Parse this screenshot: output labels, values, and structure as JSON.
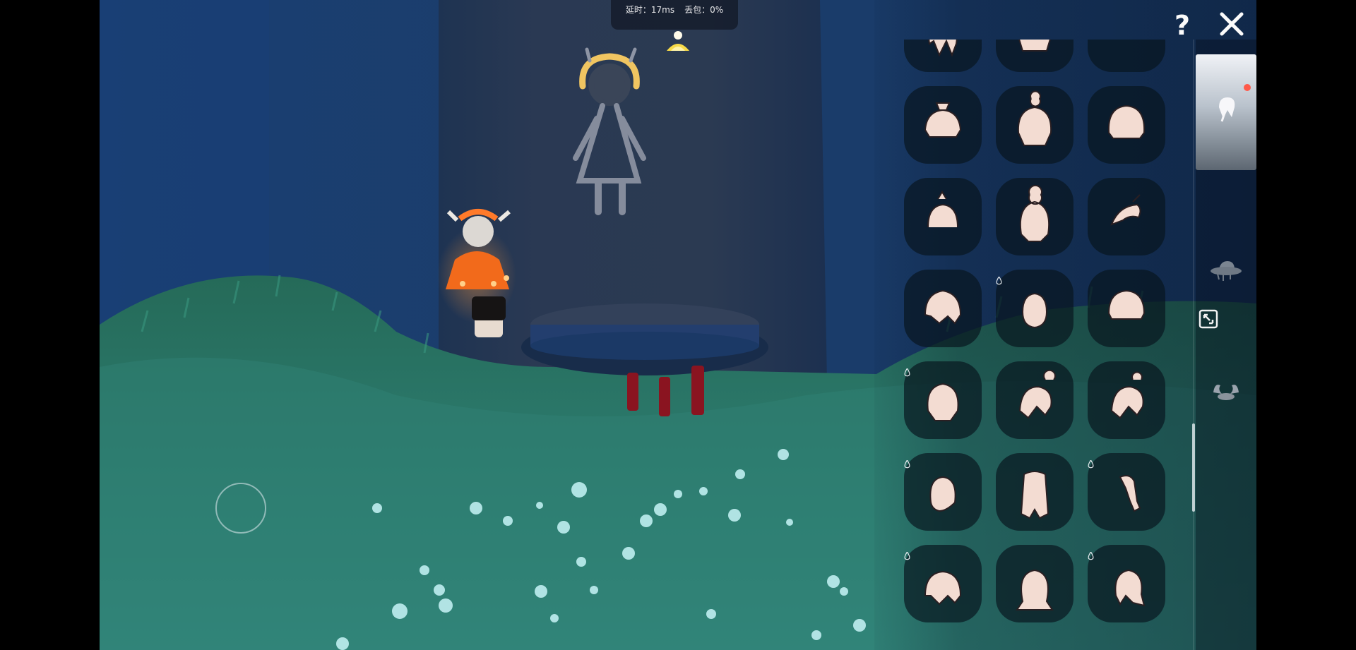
{
  "net_stats": {
    "latency": "延时：17ms",
    "packet_loss": "丢包：0%"
  },
  "help_label": "?",
  "icons": {
    "help": "question-mark-icon",
    "close": "close-x-icon",
    "expand": "expand-view-icon",
    "beacon": "candle-light-icon",
    "new_indicator": "red-dot-badge"
  },
  "colors": {
    "new_dot": "#ff5a4a",
    "slot_background": "#08141e",
    "hair_icon": "#f3dcd2",
    "accent_gold": "#f2c94c",
    "grass": "#2e7c72",
    "wall": "#173a6a"
  },
  "categories": [
    {
      "id": "hair",
      "icon": "hair-icon",
      "selected": true,
      "has_new": true
    },
    {
      "id": "hat",
      "icon": "hat-icon",
      "selected": false,
      "has_new": false
    },
    {
      "id": "horn",
      "icon": "horn-icon",
      "selected": false,
      "has_new": false
    }
  ],
  "hair_items": [
    {
      "id": 1,
      "icon": "long-hair-icon",
      "premium": false
    },
    {
      "id": 2,
      "icon": "bun-hair-icon",
      "premium": false
    },
    {
      "id": 3,
      "icon": "headband-hair-icon",
      "premium": false
    },
    {
      "id": 4,
      "icon": "side-bun-hair-icon",
      "premium": false
    },
    {
      "id": 5,
      "icon": "topknot-hair-icon",
      "premium": false
    },
    {
      "id": 6,
      "icon": "bob-hair-icon",
      "premium": false
    },
    {
      "id": 7,
      "icon": "pigtail-hair-icon",
      "premium": false
    },
    {
      "id": 8,
      "icon": "tall-bun-hair-icon",
      "premium": false
    },
    {
      "id": 9,
      "icon": "swept-hair-icon",
      "premium": false
    },
    {
      "id": 10,
      "icon": "fluffy-hair-icon",
      "premium": false
    },
    {
      "id": 11,
      "icon": "spirit-orb-icon",
      "premium": true
    },
    {
      "id": 12,
      "icon": "bowl-hair-icon",
      "premium": false
    },
    {
      "id": 13,
      "icon": "hooded-hair-icon",
      "premium": true
    },
    {
      "id": 14,
      "icon": "ponytail-hair-icon",
      "premium": false
    },
    {
      "id": 15,
      "icon": "tied-hair-icon",
      "premium": false
    },
    {
      "id": 16,
      "icon": "hood-hair-icon",
      "premium": true
    },
    {
      "id": 17,
      "icon": "long-straight-hair-icon",
      "premium": false
    },
    {
      "id": 18,
      "icon": "twist-hair-icon",
      "premium": true
    },
    {
      "id": 19,
      "icon": "messy-hair-icon",
      "premium": true
    },
    {
      "id": 20,
      "icon": "wavy-hair-icon",
      "premium": false
    },
    {
      "id": 21,
      "icon": "braided-hair-icon",
      "premium": true
    }
  ]
}
